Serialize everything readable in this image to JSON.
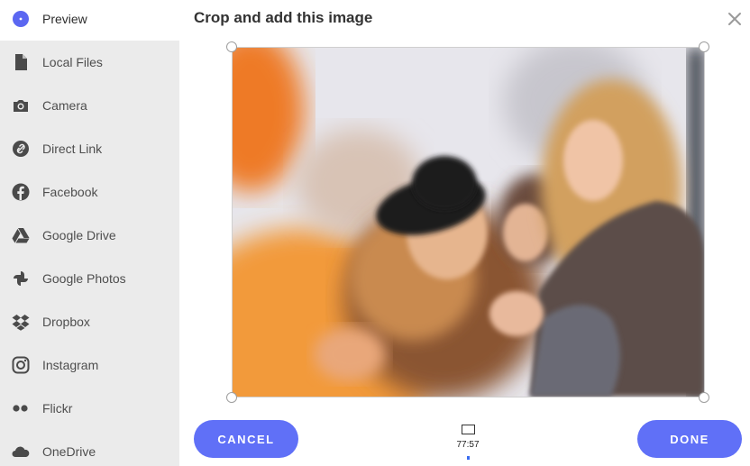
{
  "sidebar": {
    "items": [
      {
        "label": "Preview",
        "icon": "preview-icon"
      },
      {
        "label": "Local Files",
        "icon": "file-icon"
      },
      {
        "label": "Camera",
        "icon": "camera-icon"
      },
      {
        "label": "Direct Link",
        "icon": "link-icon"
      },
      {
        "label": "Facebook",
        "icon": "facebook-icon"
      },
      {
        "label": "Google Drive",
        "icon": "google-drive-icon"
      },
      {
        "label": "Google Photos",
        "icon": "google-photos-icon"
      },
      {
        "label": "Dropbox",
        "icon": "dropbox-icon"
      },
      {
        "label": "Instagram",
        "icon": "instagram-icon"
      },
      {
        "label": "Flickr",
        "icon": "flickr-icon"
      },
      {
        "label": "OneDrive",
        "icon": "onedrive-icon"
      }
    ],
    "active": "Preview"
  },
  "dialog": {
    "title": "Crop and add this image"
  },
  "actions": {
    "cancel_label": "CANCEL",
    "done_label": "DONE"
  },
  "aspect_ratio": {
    "label": "77:57"
  },
  "colors": {
    "accent": "#6070f7",
    "sidebar_bg": "#ebebeb",
    "preview_dot": "#5b67f1"
  }
}
